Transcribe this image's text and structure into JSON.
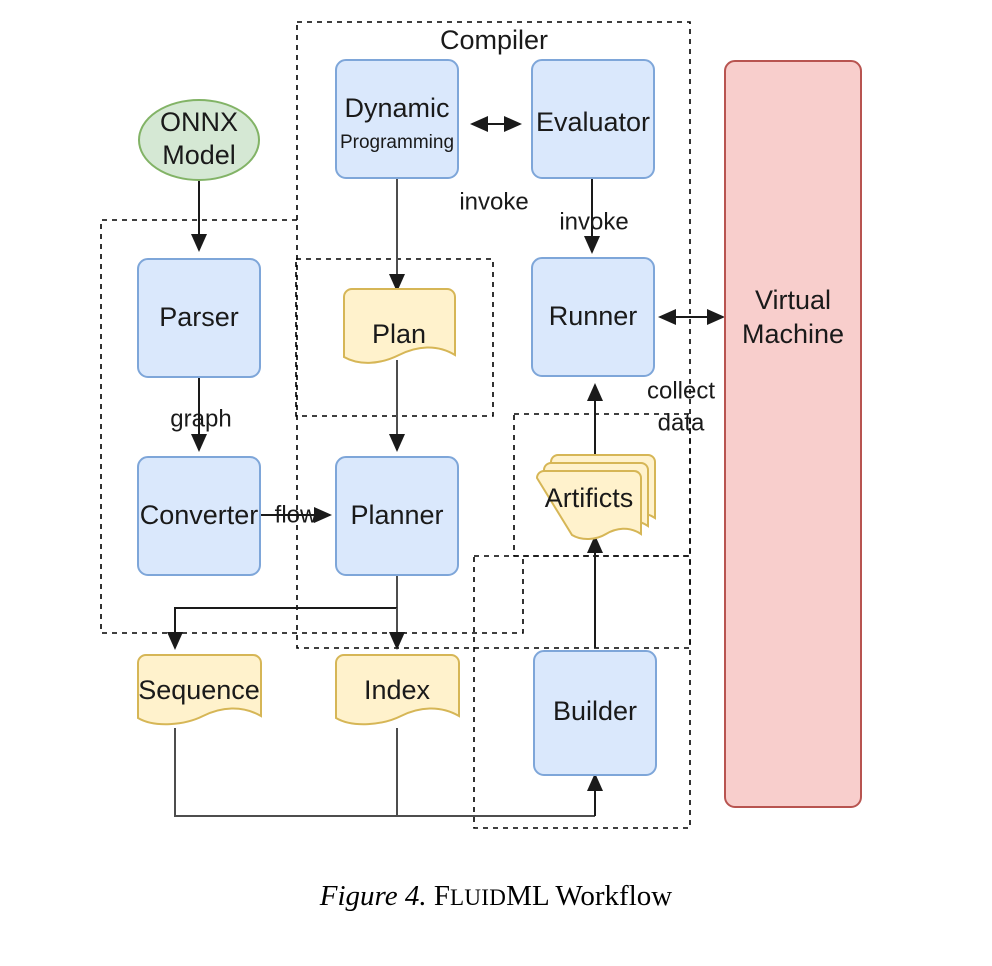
{
  "figure": {
    "caption_prefix": "Figure 4.",
    "caption_smallcaps_lead": "F",
    "caption_smallcaps_rest": "LUID",
    "caption_name_tail": "ML",
    "caption_suffix": " Workflow"
  },
  "groups": {
    "compiler": {
      "label": "Compiler"
    },
    "parser_scope": {
      "label": ""
    },
    "plan_scope": {
      "label": ""
    },
    "artifacts_scope": {
      "label": ""
    },
    "builder_scope": {
      "label": ""
    }
  },
  "nodes": {
    "onnx_model": {
      "label_line1": "ONNX",
      "label_line2": "Model",
      "shape": "ellipse",
      "color": "#d5e8d4"
    },
    "dynamic_programming": {
      "label_line1": "Dynamic",
      "label_line2": "Programming",
      "shape": "rounded-rect",
      "color": "#dae8fc"
    },
    "evaluator": {
      "label": "Evaluator",
      "shape": "rounded-rect",
      "color": "#dae8fc"
    },
    "parser": {
      "label": "Parser",
      "shape": "rounded-rect",
      "color": "#dae8fc"
    },
    "plan": {
      "label": "Plan",
      "shape": "document",
      "color": "#fff2cc"
    },
    "runner": {
      "label": "Runner",
      "shape": "rounded-rect",
      "color": "#dae8fc"
    },
    "converter": {
      "label": "Converter",
      "shape": "rounded-rect",
      "color": "#dae8fc"
    },
    "planner": {
      "label": "Planner",
      "shape": "rounded-rect",
      "color": "#dae8fc"
    },
    "artificts": {
      "label": "Artificts",
      "shape": "multi-document",
      "color": "#fff2cc"
    },
    "sequence": {
      "label": "Sequence",
      "shape": "document",
      "color": "#fff2cc"
    },
    "index": {
      "label": "Index",
      "shape": "document",
      "color": "#fff2cc"
    },
    "builder": {
      "label": "Builder",
      "shape": "rounded-rect",
      "color": "#dae8fc"
    },
    "virtual_machine": {
      "label_line1": "Virtual",
      "label_line2": "Machine",
      "shape": "rounded-rect",
      "color": "#f8cecc"
    }
  },
  "edge_labels": {
    "invoke_dp_evaluator": "invoke",
    "invoke_evaluator_runner": "invoke",
    "graph": "graph",
    "flow": "flow",
    "collect_line1": "collect",
    "collect_line2": "data"
  },
  "colors": {
    "blue_fill": "#dae8fc",
    "blue_stroke": "#7ea6d9",
    "yellow_fill": "#fff2cc",
    "yellow_stroke": "#d6b656",
    "green_fill": "#d5e8d4",
    "green_stroke": "#82b366",
    "red_fill": "#f8cecc",
    "red_stroke": "#b85450",
    "line": "#4d4d4d",
    "background": "#ffffff"
  }
}
